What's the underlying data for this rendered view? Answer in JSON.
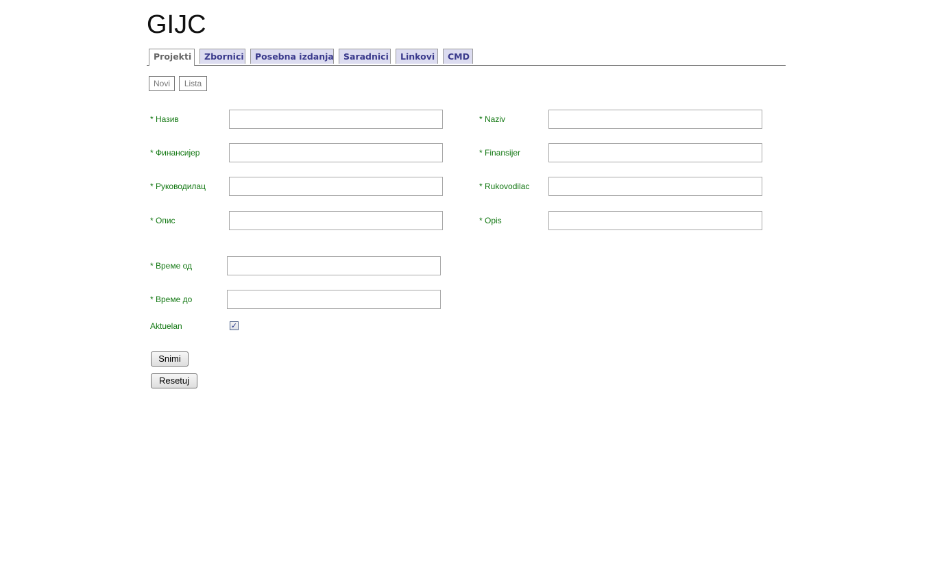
{
  "app": {
    "title": "GIJC"
  },
  "tabs": [
    {
      "label": "Projekti",
      "active": true
    },
    {
      "label": "Zbornici",
      "active": false
    },
    {
      "label": "Posebna izdanja",
      "active": false
    },
    {
      "label": "Saradnici",
      "active": false
    },
    {
      "label": "Linkovi",
      "active": false
    },
    {
      "label": "CMD",
      "active": false
    }
  ],
  "subnav": {
    "novi": "Novi",
    "lista": "Lista"
  },
  "form": {
    "cyrillic": {
      "naziv_label": "* Назив",
      "finansijer_label": "* Финансијер",
      "rukovodilac_label": "* Руководилац",
      "opis_label": "* Опис"
    },
    "latin": {
      "naziv_label": "* Naziv",
      "finansijer_label": "* Finansijer",
      "rukovodilac_label": "* Rukovodilac",
      "opis_label": "* Opis"
    },
    "vreme_od_label": "* Време од",
    "vreme_do_label": "* Време до",
    "aktuelan_label": "Aktuelan",
    "aktuelan_checked": true,
    "values": {
      "naziv_cyr": "",
      "finansijer_cyr": "",
      "rukovodilac_cyr": "",
      "opis_cyr": "",
      "naziv_lat": "",
      "finansijer_lat": "",
      "rukovodilac_lat": "",
      "opis_lat": "",
      "vreme_od": "",
      "vreme_do": ""
    }
  },
  "buttons": {
    "snimi": "Snimi",
    "resetuj": "Resetuj"
  },
  "colors": {
    "label_green": "#117711",
    "tab_text": "#3a3a8c",
    "tab_bg": "#dcdcf0"
  }
}
